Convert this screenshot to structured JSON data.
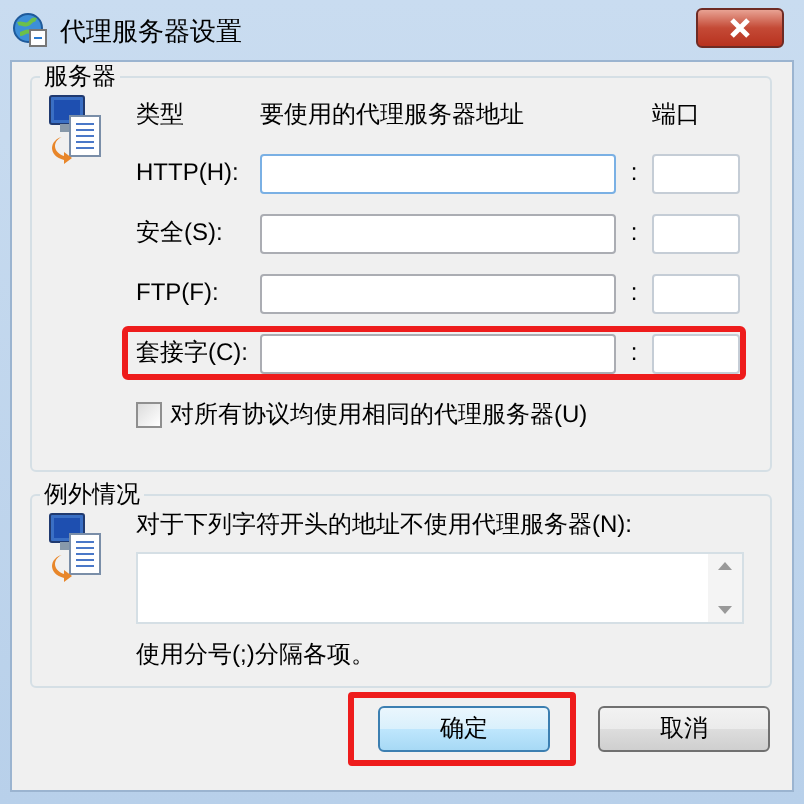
{
  "window": {
    "title": "代理服务器设置"
  },
  "servers": {
    "title": "服务器",
    "headers": {
      "type": "类型",
      "address": "要使用的代理服务器地址",
      "port": "端口"
    },
    "rows": [
      {
        "label": "HTTP(H):",
        "separator": ":",
        "focused": true,
        "highlighted": false
      },
      {
        "label": "安全(S):",
        "separator": ":",
        "focused": false,
        "highlighted": false
      },
      {
        "label": "FTP(F):",
        "separator": ":",
        "focused": false,
        "highlighted": false
      },
      {
        "label": "套接字(C):",
        "separator": ":",
        "focused": false,
        "highlighted": true
      }
    ],
    "same_proxy": {
      "label": "对所有协议均使用相同的代理服务器(U)",
      "checked": false
    }
  },
  "exceptions": {
    "title": "例外情况",
    "prompt": "对于下列字符开头的地址不使用代理服务器(N):",
    "hint": "使用分号(;)分隔各项。"
  },
  "buttons": [
    {
      "label": "确定",
      "default": true,
      "highlighted": true
    },
    {
      "label": "取消",
      "default": false,
      "highlighted": false
    }
  ]
}
